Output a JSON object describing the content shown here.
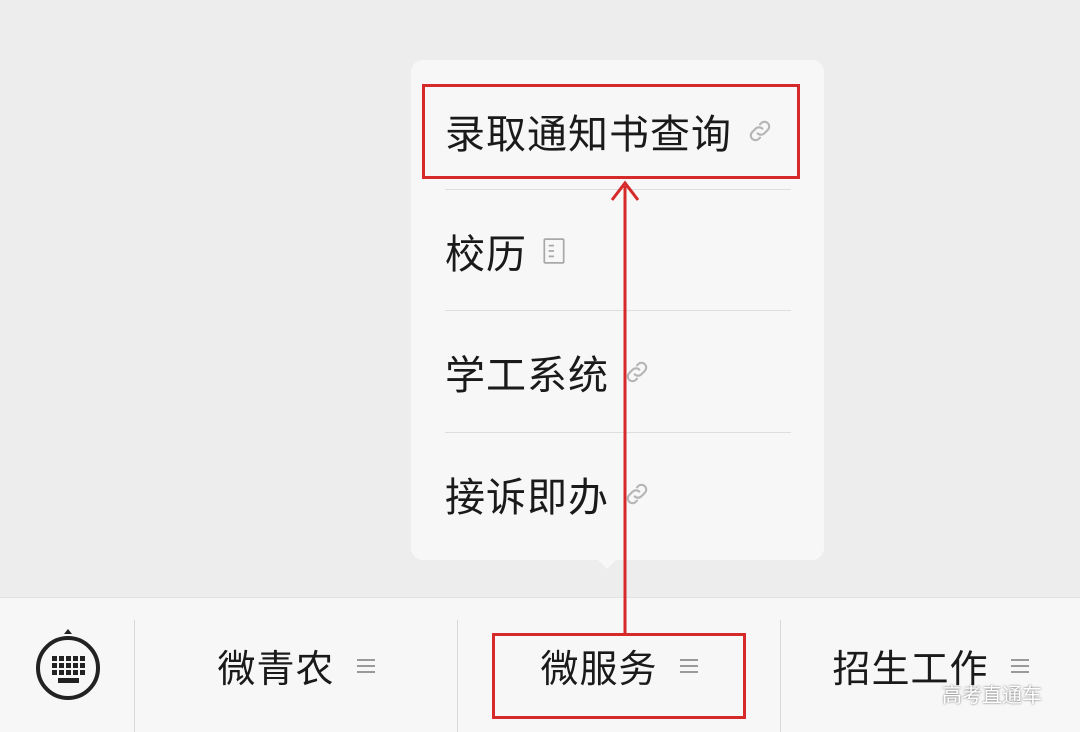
{
  "submenu": {
    "items": [
      {
        "label": "录取通知书查询",
        "icon": "link-icon"
      },
      {
        "label": "校历",
        "icon": "document-icon"
      },
      {
        "label": "学工系统",
        "icon": "link-icon"
      },
      {
        "label": "接诉即办",
        "icon": "link-icon"
      }
    ]
  },
  "tabbar": {
    "keyboard_icon": "keyboard-icon",
    "tabs": [
      {
        "label": "微青农",
        "icon": "menu-lines-icon"
      },
      {
        "label": "微服务",
        "icon": "menu-lines-icon"
      },
      {
        "label": "招生工作",
        "icon": "menu-lines-icon"
      }
    ]
  },
  "annotation": {
    "color": "#d62a2a"
  },
  "watermark": "高考直通车"
}
